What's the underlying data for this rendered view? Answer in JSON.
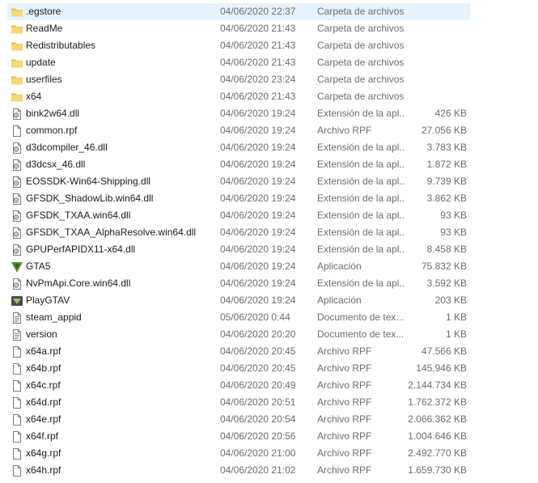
{
  "colors": {
    "selected_row": "#e5f3ff",
    "folder": "#f8d775",
    "folder_dark": "#e7b94a",
    "text": "#1b1b1b",
    "muted": "#6d6d6d",
    "gta_green": "#5a8f2d"
  },
  "files": [
    {
      "name": ".egstore",
      "date": "04/06/2020 22:37",
      "type": "Carpeta de archivos",
      "size": "",
      "icon": "folder-icon",
      "selected": true
    },
    {
      "name": "ReadMe",
      "date": "04/06/2020 21:43",
      "type": "Carpeta de archivos",
      "size": "",
      "icon": "folder-icon"
    },
    {
      "name": "Redistributables",
      "date": "04/06/2020 21:43",
      "type": "Carpeta de archivos",
      "size": "",
      "icon": "folder-icon"
    },
    {
      "name": "update",
      "date": "04/06/2020 21:43",
      "type": "Carpeta de archivos",
      "size": "",
      "icon": "folder-icon"
    },
    {
      "name": "userfiles",
      "date": "04/06/2020 23:24",
      "type": "Carpeta de archivos",
      "size": "",
      "icon": "folder-icon"
    },
    {
      "name": "x64",
      "date": "04/06/2020 21:43",
      "type": "Carpeta de archivos",
      "size": "",
      "icon": "folder-icon"
    },
    {
      "name": "bink2w64.dll",
      "date": "04/06/2020 19:24",
      "type": "Extensión de la apl...",
      "size": "426 KB",
      "icon": "dll-file-icon"
    },
    {
      "name": "common.rpf",
      "date": "04/06/2020 19:24",
      "type": "Archivo RPF",
      "size": "27.056 KB",
      "icon": "file-icon"
    },
    {
      "name": "d3dcompiler_46.dll",
      "date": "04/06/2020 19:24",
      "type": "Extensión de la apl...",
      "size": "3.783 KB",
      "icon": "dll-file-icon"
    },
    {
      "name": "d3dcsx_46.dll",
      "date": "04/06/2020 19:24",
      "type": "Extensión de la apl...",
      "size": "1.872 KB",
      "icon": "dll-file-icon"
    },
    {
      "name": "EOSSDK-Win64-Shipping.dll",
      "date": "04/06/2020 19:24",
      "type": "Extensión de la apl...",
      "size": "9.739 KB",
      "icon": "dll-file-icon"
    },
    {
      "name": "GFSDK_ShadowLib.win64.dll",
      "date": "04/06/2020 19:24",
      "type": "Extensión de la apl...",
      "size": "3.862 KB",
      "icon": "dll-file-icon"
    },
    {
      "name": "GFSDK_TXAA.win64.dll",
      "date": "04/06/2020 19:24",
      "type": "Extensión de la apl...",
      "size": "93 KB",
      "icon": "dll-file-icon"
    },
    {
      "name": "GFSDK_TXAA_AlphaResolve.win64.dll",
      "date": "04/06/2020 19:24",
      "type": "Extensión de la apl...",
      "size": "93 KB",
      "icon": "dll-file-icon"
    },
    {
      "name": "GPUPerfAPIDX11-x64.dll",
      "date": "04/06/2020 19:24",
      "type": "Extensión de la apl...",
      "size": "8.458 KB",
      "icon": "dll-file-icon"
    },
    {
      "name": "GTA5",
      "date": "04/06/2020 19:24",
      "type": "Aplicación",
      "size": "75.832 KB",
      "icon": "gta5-app-icon"
    },
    {
      "name": "NvPmApi.Core.win64.dll",
      "date": "04/06/2020 19:24",
      "type": "Extensión de la apl...",
      "size": "3.592 KB",
      "icon": "dll-file-icon"
    },
    {
      "name": "PlayGTAV",
      "date": "04/06/2020 19:24",
      "type": "Aplicación",
      "size": "203 KB",
      "icon": "playgtav-app-icon"
    },
    {
      "name": "steam_appid",
      "date": "05/06/2020 0:44",
      "type": "Documento de tex...",
      "size": "1 KB",
      "icon": "text-file-icon"
    },
    {
      "name": "version",
      "date": "04/06/2020 20:20",
      "type": "Documento de tex...",
      "size": "1 KB",
      "icon": "text-file-icon"
    },
    {
      "name": "x64a.rpf",
      "date": "04/06/2020 20:45",
      "type": "Archivo RPF",
      "size": "47.566 KB",
      "icon": "file-icon"
    },
    {
      "name": "x64b.rpf",
      "date": "04/06/2020 20:45",
      "type": "Archivo RPF",
      "size": "145.946 KB",
      "icon": "file-icon"
    },
    {
      "name": "x64c.rpf",
      "date": "04/06/2020 20:49",
      "type": "Archivo RPF",
      "size": "2.144.734 KB",
      "icon": "file-icon"
    },
    {
      "name": "x64d.rpf",
      "date": "04/06/2020 20:51",
      "type": "Archivo RPF",
      "size": "1.762.372 KB",
      "icon": "file-icon"
    },
    {
      "name": "x64e.rpf",
      "date": "04/06/2020 20:54",
      "type": "Archivo RPF",
      "size": "2.066.362 KB",
      "icon": "file-icon"
    },
    {
      "name": "x64f.rpf",
      "date": "04/06/2020 20:56",
      "type": "Archivo RPF",
      "size": "1.004.646 KB",
      "icon": "file-icon"
    },
    {
      "name": "x64g.rpf",
      "date": "04/06/2020 21:00",
      "type": "Archivo RPF",
      "size": "2.492.770 KB",
      "icon": "file-icon"
    },
    {
      "name": "x64h.rpf",
      "date": "04/06/2020 21:02",
      "type": "Archivo RPF",
      "size": "1.659.730 KB",
      "icon": "file-icon"
    }
  ]
}
